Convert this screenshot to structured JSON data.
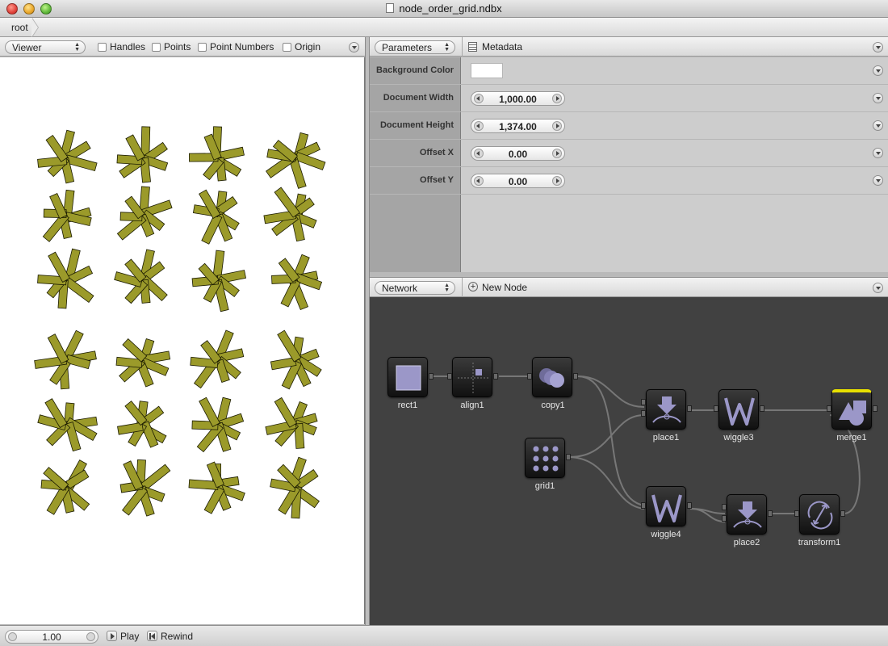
{
  "window": {
    "title": "node_order_grid.ndbx"
  },
  "breadcrumb": {
    "root": "root"
  },
  "viewer": {
    "mode": "Viewer",
    "toggles": [
      {
        "label": "Handles",
        "checked": false
      },
      {
        "label": "Points",
        "checked": false
      },
      {
        "label": "Point Numbers",
        "checked": false
      },
      {
        "label": "Origin",
        "checked": false
      }
    ],
    "shape_color": "#9b9a2a"
  },
  "parameters": {
    "tab": "Parameters",
    "metadata_label": "Metadata",
    "rows": [
      {
        "label": "Background Color",
        "kind": "color",
        "value": "#ffffff"
      },
      {
        "label": "Document Width",
        "kind": "number",
        "value": "1,000.00"
      },
      {
        "label": "Document Height",
        "kind": "number",
        "value": "1,374.00"
      },
      {
        "label": "Offset X",
        "kind": "number",
        "value": "0.00"
      },
      {
        "label": "Offset Y",
        "kind": "number",
        "value": "0.00"
      }
    ]
  },
  "network": {
    "mode": "Network",
    "new_node_label": "New Node",
    "nodes": [
      {
        "id": "rect1",
        "icon": "rect-icon"
      },
      {
        "id": "align1",
        "icon": "align-icon"
      },
      {
        "id": "copy1",
        "icon": "copy-icon"
      },
      {
        "id": "grid1",
        "icon": "grid-icon"
      },
      {
        "id": "place1",
        "icon": "place-icon"
      },
      {
        "id": "wiggle3",
        "icon": "wiggle-icon"
      },
      {
        "id": "merge1",
        "icon": "merge-icon",
        "rendered": true
      },
      {
        "id": "wiggle4",
        "icon": "wiggle-icon"
      },
      {
        "id": "place2",
        "icon": "place-icon"
      },
      {
        "id": "transform1",
        "icon": "transform-icon"
      }
    ]
  },
  "playback": {
    "frame": "1.00",
    "play_label": "Play",
    "rewind_label": "Rewind"
  }
}
